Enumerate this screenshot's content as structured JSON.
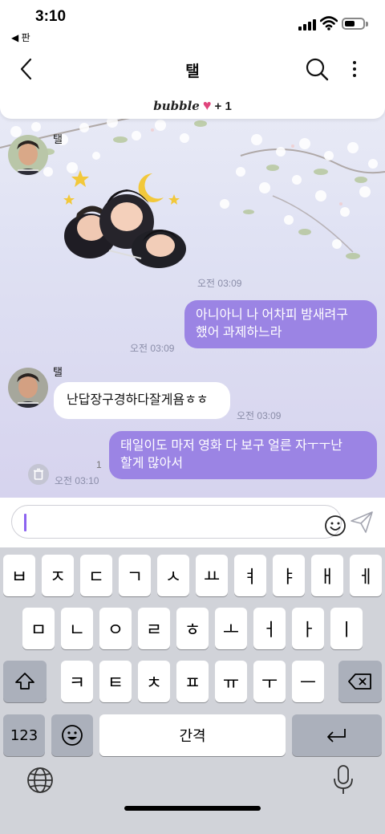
{
  "status": {
    "time": "3:10",
    "back_app": "◀ 판"
  },
  "nav": {
    "title": "탤"
  },
  "banner": {
    "brand": "bubble",
    "heart": "♥",
    "plus": "+ 1"
  },
  "messages": [
    {
      "type": "sticker",
      "sender": "탤",
      "time": "오전 03:09"
    },
    {
      "type": "outgoing",
      "line1": "아니아니 나 어차피 밤새려구",
      "line2": "했어 과제하느라",
      "time": "오전 03:09"
    },
    {
      "type": "incoming",
      "sender": "탤",
      "text": "난답장구경하다잘게욤ㅎㅎ",
      "time": "오전 03:09"
    },
    {
      "type": "outgoing",
      "line1": "태일이도 마저 영화 다 보구 얼른 자ㅜㅜ난",
      "line2": "할게 많아서",
      "time": "오전 03:10",
      "unread": "1"
    }
  ],
  "composer": {
    "placeholder": "",
    "emoji_icon": "smiley-icon",
    "send_icon": "paper-plane-icon"
  },
  "keyboard": {
    "row1": [
      "ㅂ",
      "ㅈ",
      "ㄷ",
      "ㄱ",
      "ㅅ",
      "ㅛ",
      "ㅕ",
      "ㅑ",
      "ㅐ",
      "ㅔ"
    ],
    "row2": [
      "ㅁ",
      "ㄴ",
      "ㅇ",
      "ㄹ",
      "ㅎ",
      "ㅗ",
      "ㅓ",
      "ㅏ",
      "ㅣ"
    ],
    "row3": [
      "ㅋ",
      "ㅌ",
      "ㅊ",
      "ㅍ",
      "ㅠ",
      "ㅜ",
      "ㅡ"
    ],
    "numbers_label": "123",
    "space_label": "간격",
    "icons": {
      "shift": "shift-icon",
      "delete": "backspace-icon",
      "emoji": "emoji-icon",
      "return": "return-icon",
      "globe": "globe-icon",
      "mic": "microphone-icon"
    }
  },
  "colors": {
    "outgoing_bubble": "#9b84e4",
    "cursor": "#8c63f0",
    "heart": "#e0447c",
    "keyboard_bg": "#d1d3d9"
  }
}
